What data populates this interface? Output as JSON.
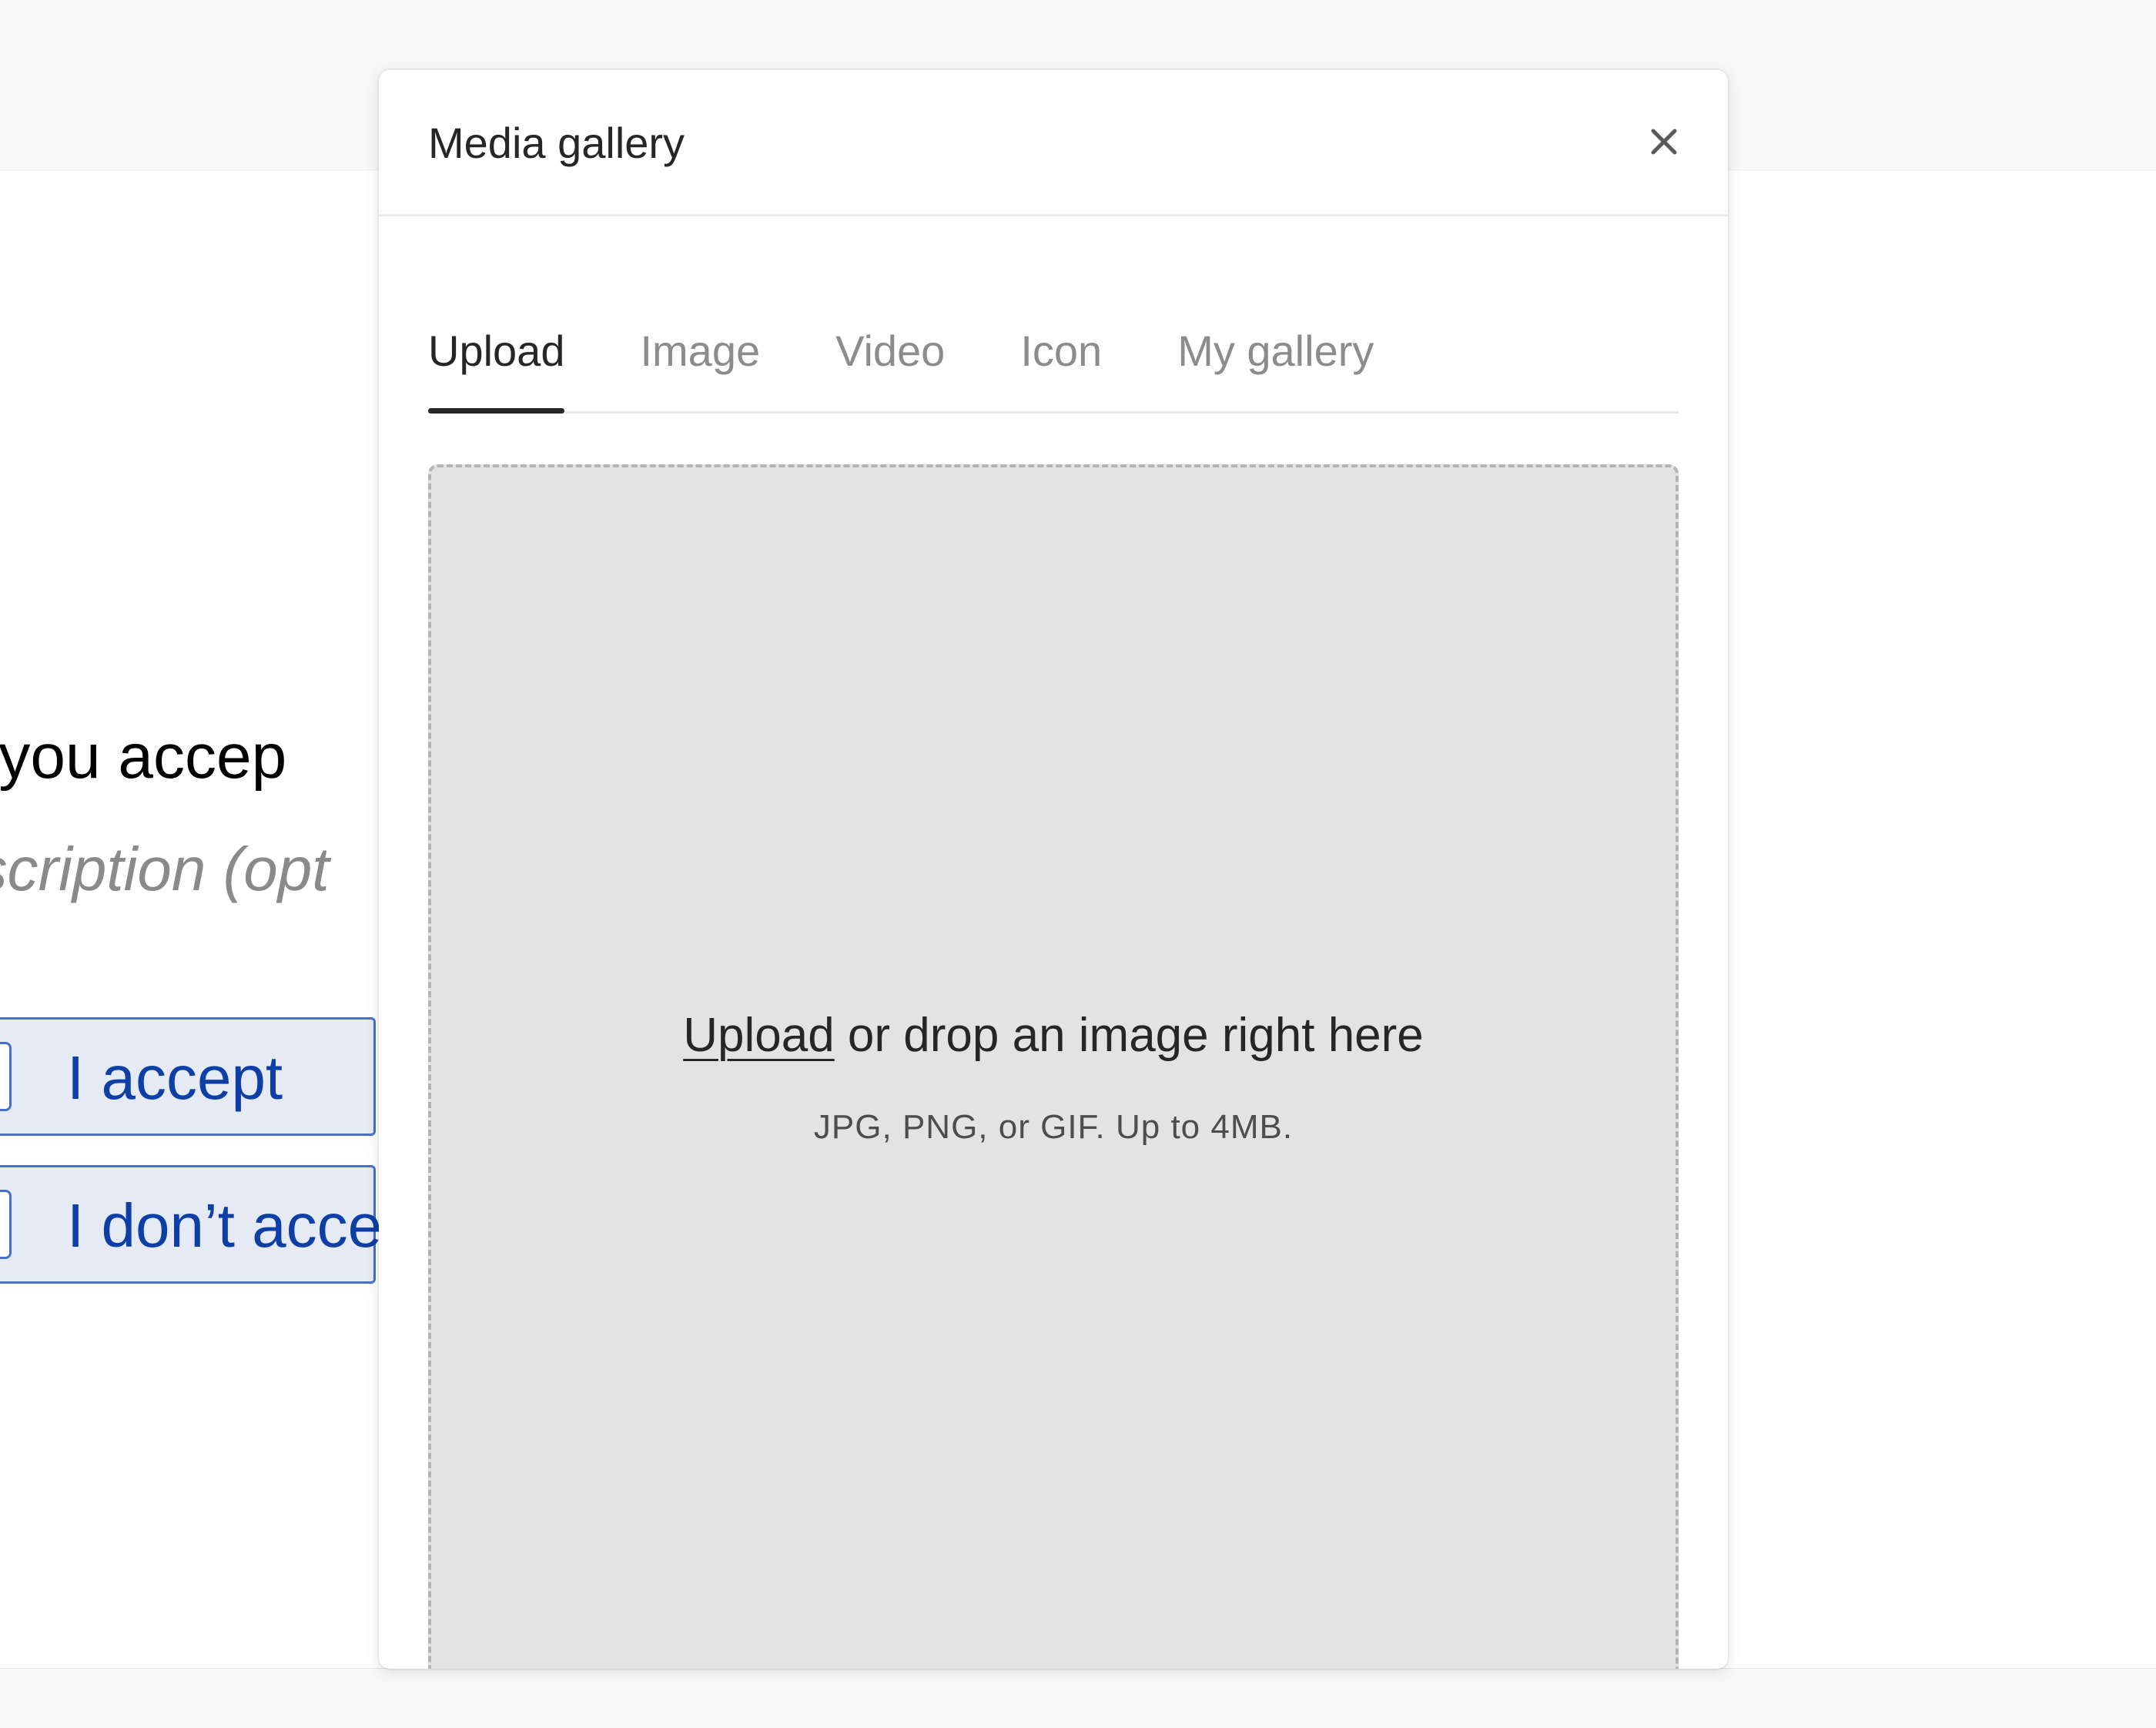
{
  "background": {
    "question": "o you accep",
    "description": "escription (opt",
    "choices": [
      {
        "key": "A",
        "label": "I accept"
      },
      {
        "key": "B",
        "label": "I don’t acce"
      }
    ]
  },
  "modal": {
    "title": "Media gallery",
    "close_icon": "close-icon",
    "tabs": [
      {
        "label": "Upload",
        "active": true
      },
      {
        "label": "Image",
        "active": false
      },
      {
        "label": "Video",
        "active": false
      },
      {
        "label": "Icon",
        "active": false
      },
      {
        "label": "My gallery",
        "active": false
      }
    ],
    "dropzone": {
      "link_text": "Upload",
      "text": " or drop an image right here",
      "hint": "JPG, PNG, or GIF. Up to 4MB."
    }
  },
  "colors": {
    "accent_blue": "#0d3fa6",
    "choice_bg": "#e5eaf4",
    "dropzone_bg": "#e3e3e3",
    "text_dark": "#262627",
    "tab_inactive": "#8c8c8c"
  }
}
